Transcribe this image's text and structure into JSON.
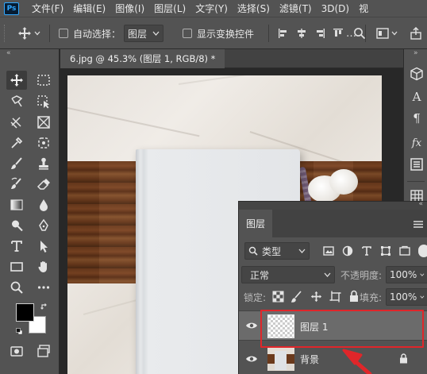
{
  "app": {
    "logo": "Ps"
  },
  "menu": [
    "文件(F)",
    "编辑(E)",
    "图像(I)",
    "图层(L)",
    "文字(Y)",
    "选择(S)",
    "滤镜(T)",
    "3D(D)",
    "视"
  ],
  "options": {
    "auto_select_label": "自动选择：",
    "auto_select_value": "图层",
    "show_transform_label": "显示变换控件"
  },
  "document": {
    "tab_title": "6.jpg @ 45.3% (图层 1, RGB/8) *"
  },
  "layers_panel": {
    "title": "图层",
    "filter_kind": "类型",
    "blend_mode": "正常",
    "opacity_label": "不透明度:",
    "opacity_value": "100%",
    "lock_label": "锁定:",
    "fill_label": "填充:",
    "fill_value": "100%",
    "layers": [
      {
        "name": "图层 1",
        "selected": true
      },
      {
        "name": "背景",
        "locked": true
      }
    ]
  },
  "colors": {
    "ui_bg": "#535353",
    "panel_dark": "#424242",
    "selected_layer": "#6b6b6b",
    "highlight_red": "#e0262a",
    "arrow_red": "#e0262a",
    "foreground": "#000000",
    "background": "#ffffff"
  }
}
